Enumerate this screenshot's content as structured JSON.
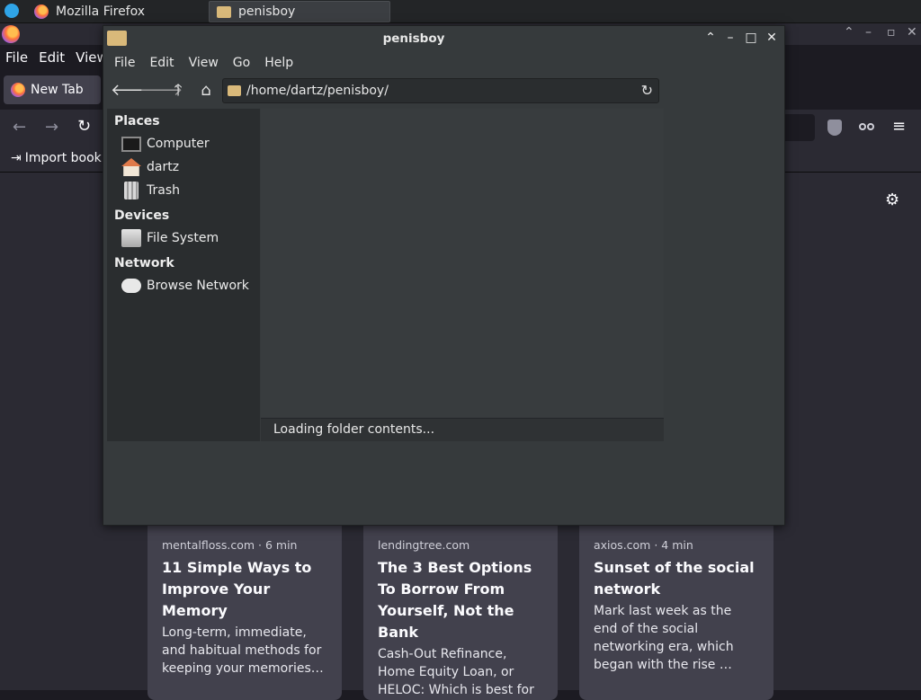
{
  "taskbar": {
    "firefox_label": "Mozilla Firefox",
    "filemanager_label": "penisboy"
  },
  "firefox": {
    "menu": [
      "File",
      "Edit",
      "View"
    ],
    "tab_title": "New Tab",
    "import_bookmarks": "Import book",
    "cards": [
      {
        "meta": "mentalfloss.com · 6 min",
        "title": "11 Simple Ways to Improve Your Memory",
        "desc": "Long-term, immediate, and habitual methods for keeping your memories…"
      },
      {
        "meta": "lendingtree.com",
        "title": "The 3 Best Options To Borrow From Yourself, Not the Bank",
        "desc": "Cash-Out Refinance, Home Equity Loan, or HELOC: Which is best for you?"
      },
      {
        "meta": "axios.com · 4 min",
        "title": "Sunset of the social network",
        "desc": "Mark last week as the end of the social networking era, which began with the rise …"
      }
    ]
  },
  "filemanager": {
    "title": "penisboy",
    "menu": [
      "File",
      "Edit",
      "View",
      "Go",
      "Help"
    ],
    "location": "/home/dartz/penisboy/",
    "status": "Loading folder contents...",
    "sidebar": {
      "places_header": "Places",
      "places": [
        "Computer",
        "dartz",
        "Trash"
      ],
      "devices_header": "Devices",
      "devices": [
        "File System"
      ],
      "network_header": "Network",
      "network": [
        "Browse Network"
      ]
    }
  },
  "colors": {
    "firefox_bg": "#2b2a33",
    "card_bg": "#42414d",
    "fm_bg": "#363a3c"
  }
}
